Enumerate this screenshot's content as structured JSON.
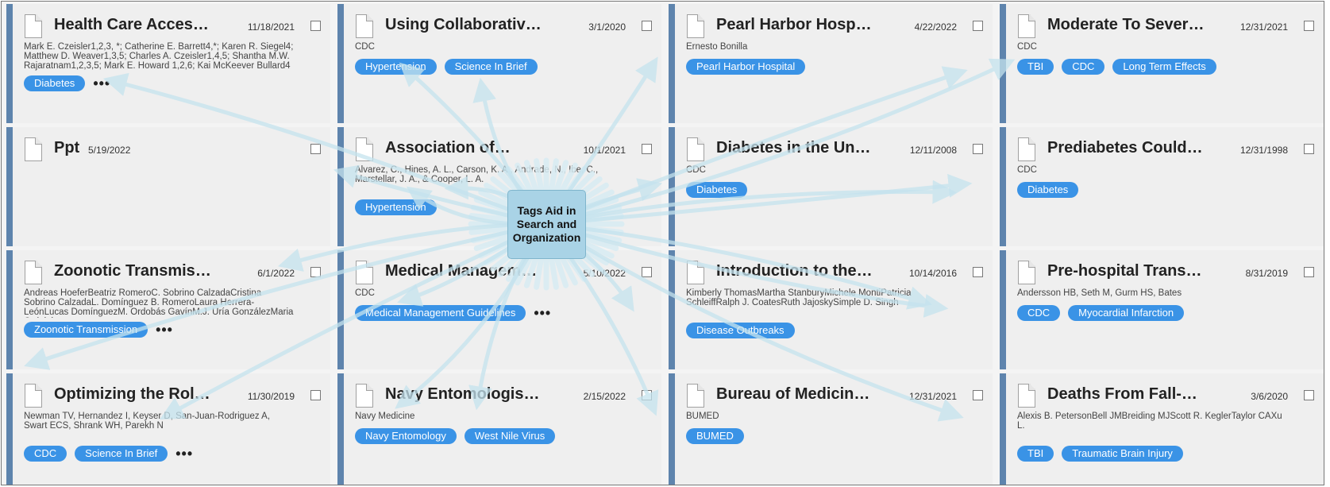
{
  "cards": [
    {
      "title": "Health Care Access…",
      "date": "11/18/2021",
      "authors": "Mark E. Czeisler1,2,3, *; Catherine E. Barrett4,*; Karen R. Siegel4; Matthew D. Weaver1,3,5; Charles A. Czeisler1,4,5; Shantha M.W. Rajaratnam1,2,3,5; Mark E. Howard 1,2,6; Kai McKeever Bullard4",
      "tags": [
        "Diabetes"
      ],
      "more": "•••"
    },
    {
      "title": "Using Collaborative…",
      "date": "3/1/2020",
      "authors": "CDC",
      "tags": [
        "Hypertension",
        "Science In Brief"
      ],
      "more": ""
    },
    {
      "title": "Pearl Harbor Hospital…",
      "date": "4/22/2022",
      "authors": "Ernesto Bonilla",
      "tags": [
        "Pearl Harbor Hospital"
      ],
      "more": ""
    },
    {
      "title": "Moderate To Severe…",
      "date": "12/31/2021",
      "authors": "CDC",
      "tags": [
        "TBI",
        "CDC",
        "Long Term Effects"
      ],
      "more": ""
    },
    {
      "title": "Ppt",
      "date": "5/19/2022",
      "authors": "",
      "tags": [],
      "more": ""
    },
    {
      "title": "Association of…",
      "date": "10/1/2021",
      "authors": "Alvarez, C., Hines, A. L., Carson, K. A., Andrade, N., Ibe, C., Marstellar, J. A., & Cooper, L. A.",
      "tags": [
        "Hypertension"
      ],
      "more": ""
    },
    {
      "title": "Diabetes in the Unite…",
      "date": "12/11/2008",
      "authors": "CDC",
      "tags": [
        "Diabetes"
      ],
      "more": ""
    },
    {
      "title": "Prediabetes Could It …",
      "date": "12/31/1998",
      "authors": "CDC",
      "tags": [
        "Diabetes"
      ],
      "more": ""
    },
    {
      "title": "Zoonotic Transmissio…",
      "date": "6/1/2022",
      "authors": "Andreas HoeferBeatriz RomeroC. Sobrino CalzadaCristina Sobrino CalzadaL. Domínguez B. RomeroLaura Herrera-LeónLucas DomínguezM. Ordobás GavínM.J. Uría GonzálezMaria Ordobás…",
      "tags": [
        "Zoonotic Transmission"
      ],
      "more": "•••"
    },
    {
      "title": "Medical Management…",
      "date": "5/10/2022",
      "authors": "CDC",
      "tags": [
        "Medical Management Guidelines"
      ],
      "more": "•••"
    },
    {
      "title": "Introduction to the…",
      "date": "10/14/2016",
      "authors": "Kimberly ThomasMartha StanburyMichele MontiPatricia SchleiffRalph J. CoatesRuth JajoskySimple D. Singh",
      "tags": [
        "Disease Outbreaks"
      ],
      "more": ""
    },
    {
      "title": "Pre-hospital Transpor…",
      "date": "8/31/2019",
      "authors": "Andersson HB, Seth M, Gurm HS, Bates",
      "tags": [
        "CDC",
        "Myocardial Infarction"
      ],
      "more": ""
    },
    {
      "title": "Optimizing the Role o…",
      "date": "11/30/2019",
      "authors": "Newman TV, Hernandez I, Keyser D, San-Juan-Rodriguez A, Swart ECS, Shrank WH, Parekh N",
      "tags": [
        "CDC",
        "Science In Brief"
      ],
      "more": "•••"
    },
    {
      "title": "Navy Entomologist…",
      "date": "2/15/2022",
      "authors": "Navy Medicine",
      "tags": [
        "Navy Entomology",
        "West Nile Virus"
      ],
      "more": ""
    },
    {
      "title": "Bureau of Medicine a…",
      "date": "12/31/2021",
      "authors": "BUMED",
      "tags": [
        "BUMED"
      ],
      "more": ""
    },
    {
      "title": "Deaths From Fall-…",
      "date": "3/6/2020",
      "authors": "Alexis B. PetersonBell JMBreiding MJScott R. KeglerTaylor CAXu L.",
      "tags": [
        "TBI",
        "Traumatic Brain Injury"
      ],
      "more": ""
    }
  ],
  "overlay": {
    "note_text": "Tags Aid in Search and Organization",
    "arrow_color": "#c5e3ee"
  }
}
